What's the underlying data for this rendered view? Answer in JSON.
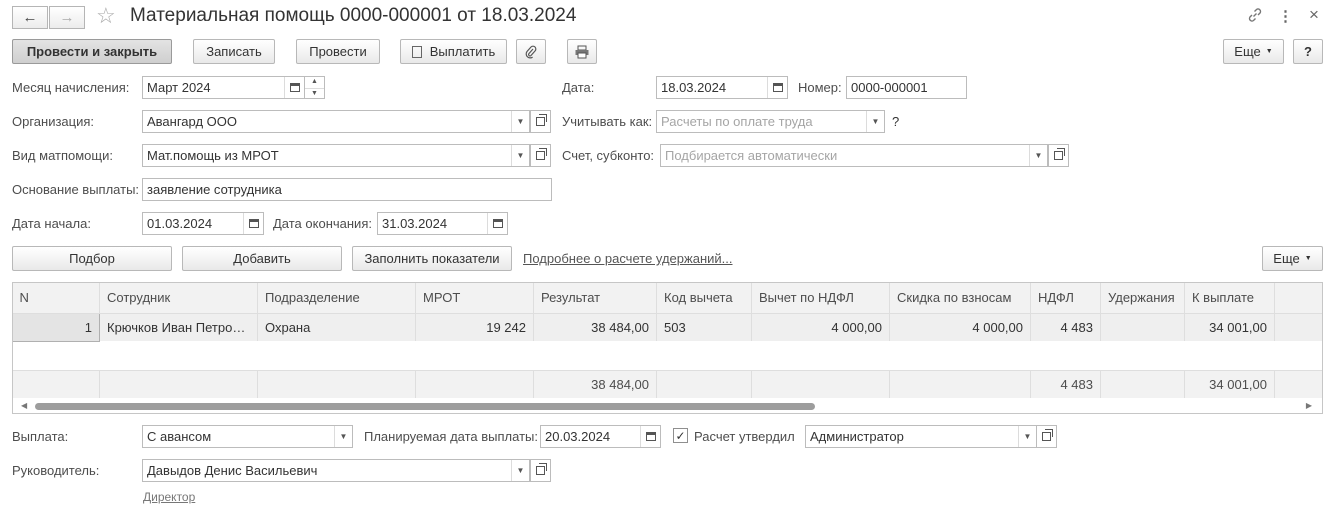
{
  "window": {
    "title": "Материальная помощь 0000-000001 от 18.03.2024",
    "back_icon": "←",
    "forward_icon": "→",
    "star_icon": "☆",
    "link_icon": "🔗",
    "menu_icon": "⋮",
    "close_icon": "×"
  },
  "toolbar": {
    "post_close": "Провести и закрыть",
    "save": "Записать",
    "post": "Провести",
    "pay": "Выплатить",
    "more": "Еще",
    "help": "?"
  },
  "form": {
    "month_label": "Месяц начисления:",
    "month_value": "Март 2024",
    "date_label": "Дата:",
    "date_value": "18.03.2024",
    "number_label": "Номер:",
    "number_value": "0000-000001",
    "org_label": "Организация:",
    "org_value": "Авангард ООО",
    "account_as_label": "Учитывать как:",
    "account_as_placeholder": "Расчеты по оплате труда",
    "account_as_help": "?",
    "aid_type_label": "Вид матпомощи:",
    "aid_type_value": "Мат.помощь из МРОТ",
    "subconto_label": "Счет, субконто:",
    "subconto_placeholder": "Подбирается автоматически",
    "basis_label": "Основание выплаты:",
    "basis_value": "заявление сотрудника",
    "start_label": "Дата начала:",
    "start_value": "01.03.2024",
    "end_label": "Дата окончания:",
    "end_value": "31.03.2024"
  },
  "table_toolbar": {
    "pick": "Подбор",
    "add": "Добавить",
    "fill": "Заполнить показатели",
    "details_link": "Подробнее о расчете удержаний...",
    "more": "Еще"
  },
  "table": {
    "headers": [
      "N",
      "Сотрудник",
      "Подразделение",
      "МРОТ",
      "Результат",
      "Код вычета",
      "Вычет по НДФЛ",
      "Скидка по взносам",
      "НДФЛ",
      "Удержания",
      "К выплате"
    ],
    "rows": [
      [
        "1",
        "Крючков Иван Петрович",
        "Охрана",
        "19 242",
        "38 484,00",
        "503",
        "4 000,00",
        "4 000,00",
        "4 483",
        "",
        "34 001,00"
      ]
    ],
    "totals": [
      "",
      "",
      "",
      "",
      "38 484,00",
      "",
      "",
      "",
      "4 483",
      "",
      "34 001,00"
    ]
  },
  "footer": {
    "payment_label": "Выплата:",
    "payment_value": "С авансом",
    "planned_date_label": "Планируемая дата выплаты:",
    "planned_date_value": "20.03.2024",
    "approved_label": "Расчет утвердил",
    "approved_checked": "✓",
    "approved_value": "Администратор",
    "head_label": "Руководитель:",
    "head_value": "Давыдов Денис Васильевич",
    "head_position_link": "Директор"
  }
}
